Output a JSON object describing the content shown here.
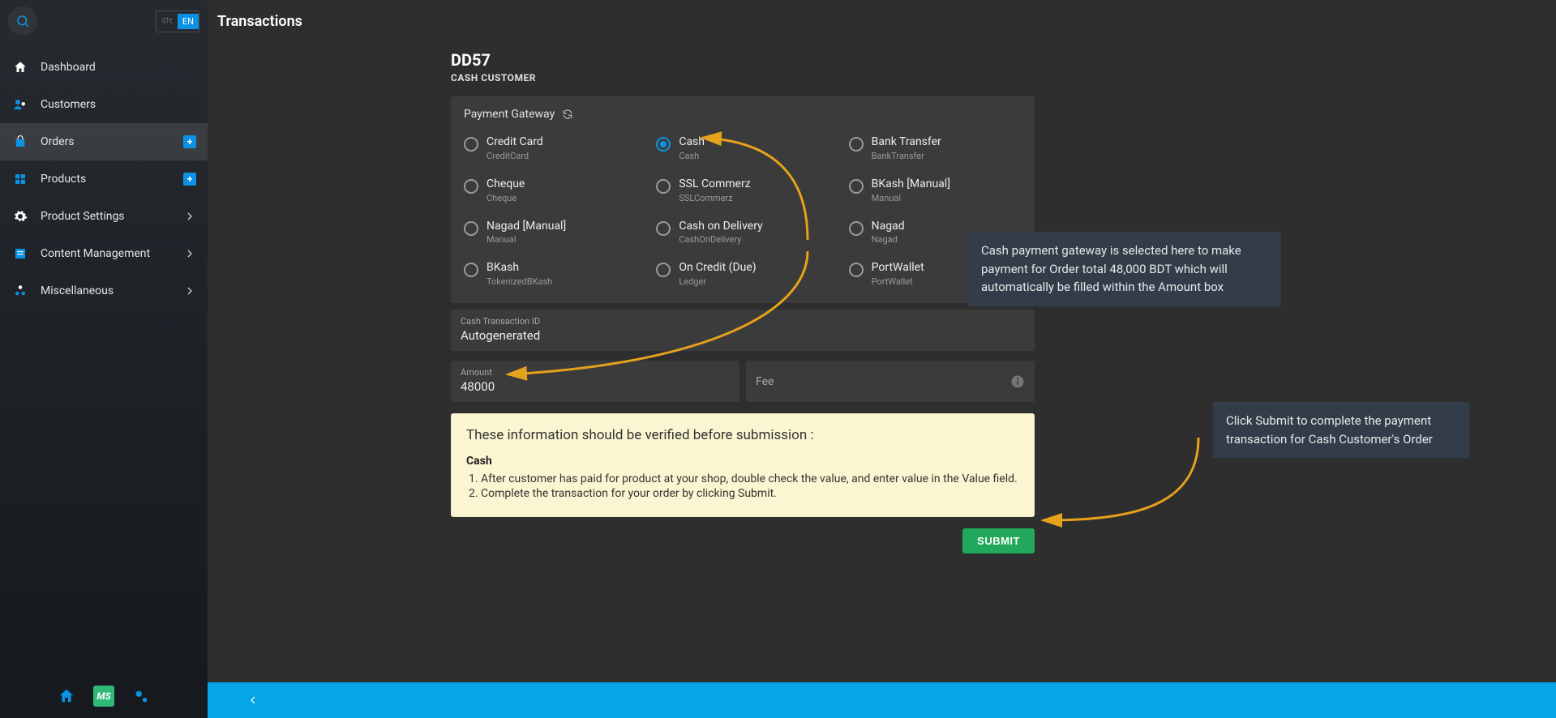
{
  "lang": {
    "bn": "বাং",
    "en": "EN"
  },
  "sidebar": {
    "items": [
      {
        "label": "Dashboard"
      },
      {
        "label": "Customers"
      },
      {
        "label": "Orders"
      },
      {
        "label": "Products"
      },
      {
        "label": "Product Settings"
      },
      {
        "label": "Content Management"
      },
      {
        "label": "Miscellaneous"
      }
    ]
  },
  "header": {
    "title": "Transactions"
  },
  "order": {
    "code": "DD57",
    "customer": "CASH CUSTOMER"
  },
  "gateway": {
    "title": "Payment Gateway",
    "options": [
      {
        "label": "Credit Card",
        "sub": "CreditCard",
        "selected": false
      },
      {
        "label": "Cash",
        "sub": "Cash",
        "selected": true
      },
      {
        "label": "Bank Transfer",
        "sub": "BankTransfer",
        "selected": false
      },
      {
        "label": "Cheque",
        "sub": "Cheque",
        "selected": false
      },
      {
        "label": "SSL Commerz",
        "sub": "SSLCommerz",
        "selected": false
      },
      {
        "label": "BKash [Manual]",
        "sub": "Manual",
        "selected": false
      },
      {
        "label": "Nagad [Manual]",
        "sub": "Manual",
        "selected": false
      },
      {
        "label": "Cash on Delivery",
        "sub": "CashOnDelivery",
        "selected": false
      },
      {
        "label": "Nagad",
        "sub": "Nagad",
        "selected": false
      },
      {
        "label": "BKash",
        "sub": "TokenizedBKash",
        "selected": false
      },
      {
        "label": "On Credit (Due)",
        "sub": "Ledger",
        "selected": false
      },
      {
        "label": "PortWallet",
        "sub": "PortWallet",
        "selected": false
      }
    ]
  },
  "fields": {
    "txn_id_label": "Cash Transaction ID",
    "txn_id_value": "Autogenerated",
    "amount_label": "Amount",
    "amount_value": "48000",
    "fee_label": "Fee"
  },
  "info": {
    "heading": "These information should be verified before submission :",
    "section": "Cash",
    "steps": [
      "After customer has paid for product at your shop, double check the value, and enter value in the Value field.",
      "Complete the transaction for your order by clicking Submit."
    ]
  },
  "submit": {
    "label": "SUBMIT"
  },
  "annotations": {
    "a1": "Cash payment gateway is selected here to make payment for Order total 48,000 BDT which will automatically be filled within the Amount box",
    "a2": "Click Submit to complete the payment transaction for Cash Customer's Order"
  }
}
